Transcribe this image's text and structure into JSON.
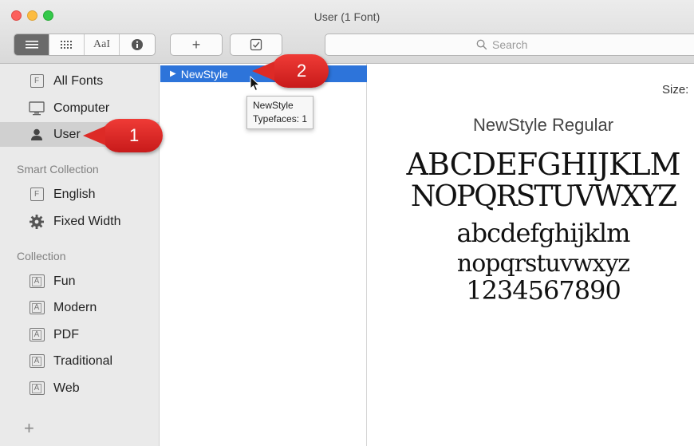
{
  "window": {
    "title": "User (1 Font)"
  },
  "toolbar": {
    "view_buttons": [
      "≣",
      "::::",
      "AaI",
      "i"
    ],
    "add_button": "+",
    "check_button": "✓",
    "search_placeholder": "Search"
  },
  "sidebar": {
    "library_items": [
      {
        "label": "All Fonts",
        "icon": "font-document-icon"
      },
      {
        "label": "Computer",
        "icon": "monitor-icon"
      },
      {
        "label": "User",
        "icon": "person-icon",
        "selected": true
      }
    ],
    "smart_collection_heading": "Smart Collection",
    "smart_items": [
      {
        "label": "English",
        "icon": "font-document-icon"
      },
      {
        "label": "Fixed Width",
        "icon": "gear-icon"
      }
    ],
    "collection_heading": "Collection",
    "collection_items": [
      {
        "label": "Fun",
        "icon": "collection-icon"
      },
      {
        "label": "Modern",
        "icon": "collection-icon"
      },
      {
        "label": "PDF",
        "icon": "collection-icon"
      },
      {
        "label": "Traditional",
        "icon": "collection-icon"
      },
      {
        "label": "Web",
        "icon": "collection-icon"
      }
    ],
    "add_label": "+"
  },
  "font_list": {
    "rows": [
      {
        "label": "NewStyle",
        "disclosure": "▶"
      }
    ],
    "tooltip": {
      "line1": "NewStyle",
      "line2": "Typefaces: 1"
    }
  },
  "preview": {
    "size_label": "Size:",
    "font_name": "NewStyle Regular",
    "lines": [
      "ABCDEFGHIJKLM",
      "NOPQRSTUVWXYZ",
      "abcdefghijklm",
      "nopqrstuvwxyz",
      "1234567890"
    ]
  },
  "callouts": [
    {
      "number": "1",
      "points_to": "User"
    },
    {
      "number": "2",
      "points_to": "NewStyle"
    }
  ],
  "colors": {
    "selection_blue": "#2d74da",
    "callout_red": "#dd2a26",
    "sidebar_bg": "#eaeaea"
  }
}
